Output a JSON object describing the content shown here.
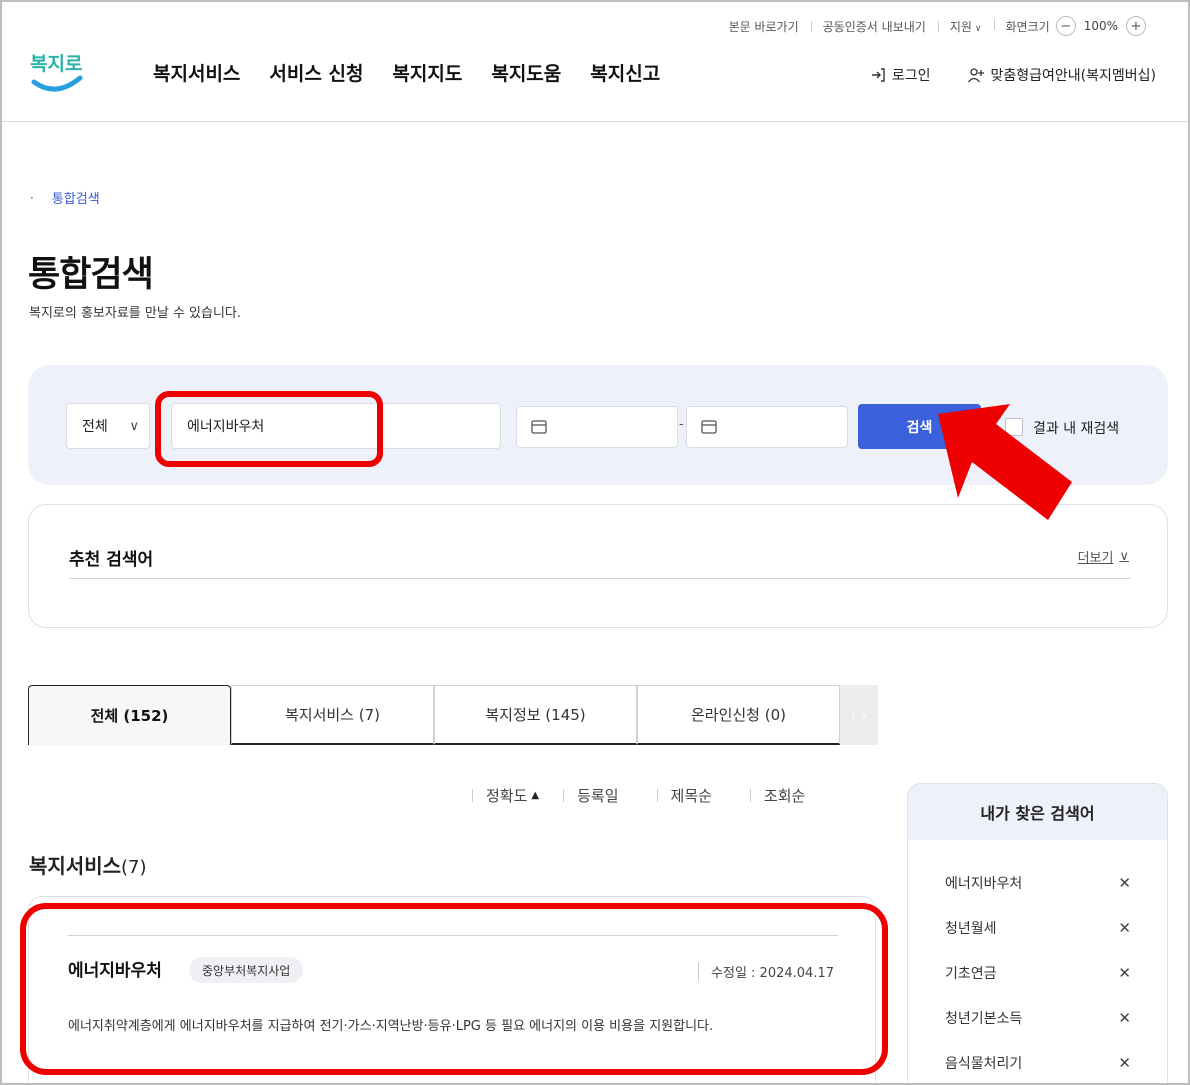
{
  "utility": {
    "skip_link": "본문 바로가기",
    "cert_export": "공동인증서 내보내기",
    "support": "지원",
    "screen_size": "화면크기",
    "zoom_out": "−",
    "zoom_level": "100%",
    "zoom_in": "+"
  },
  "logo": {
    "text": "복지로",
    "icon": "bokjiro-logo"
  },
  "gnb": [
    "복지서비스",
    "서비스 신청",
    "복지지도",
    "복지도움",
    "복지신고"
  ],
  "header_right": {
    "login": "로그인",
    "membership": "맞춤형급여안내(복지멤버십)"
  },
  "breadcrumb": {
    "current": "통합검색"
  },
  "page": {
    "title": "통합검색",
    "subtitle": "복지로의 홍보자료를 만날 수 있습니다."
  },
  "search": {
    "scope": "전체",
    "keyword": "에너지바우처",
    "date_sep": "-",
    "button": "검색",
    "re_search_label": "결과 내 재검색"
  },
  "recommended": {
    "title": "추천 검색어",
    "more": "더보기"
  },
  "tabs": [
    {
      "label": "전체  (152)"
    },
    {
      "label": "복지서비스 (7)"
    },
    {
      "label": "복지정보 (145)"
    },
    {
      "label": "온라인신청 (0)"
    }
  ],
  "sort": {
    "accuracy": "정확도",
    "date": "등록일",
    "title": "제목순",
    "views": "조회순"
  },
  "section": {
    "title": "복지서비스",
    "count": "(7)"
  },
  "result": {
    "title": "에너지바우처",
    "badge": "중앙부처복지사업",
    "modified": "수정일 : 2024.04.17",
    "desc": "에너지취약계층에게 에너지바우처를 지급하여 전기·가스·지역난방·등유·LPG 등 필요 에너지의 이용 비용을 지원합니다."
  },
  "my_searches": {
    "title": "내가 찾은 검색어",
    "items": [
      "에너지바우처",
      "청년월세",
      "기초연금",
      "청년기본소득",
      "음식물처리기"
    ]
  },
  "colors": {
    "primary": "#3b60dc",
    "highlight": "#ee0000",
    "panel_bg": "#eef1fa"
  }
}
